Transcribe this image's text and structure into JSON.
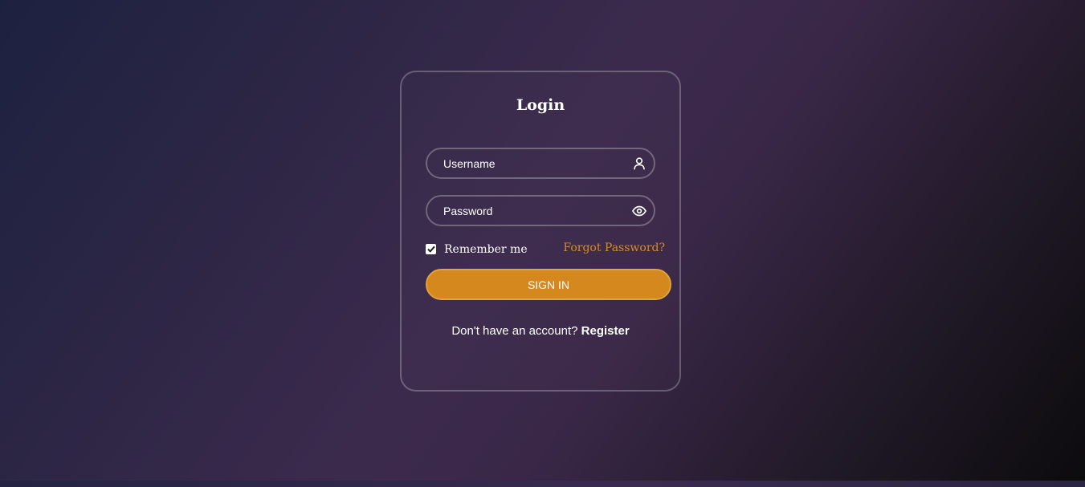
{
  "login": {
    "title": "Login",
    "username": {
      "placeholder": "Username",
      "value": "",
      "icon": "user-icon"
    },
    "password": {
      "placeholder": "Password",
      "value": "",
      "icon": "eye-icon"
    },
    "remember": {
      "label": "Remember me",
      "checked": true
    },
    "forgot_label": "Forgot Password?",
    "signin_label": "SIGN IN",
    "register_prompt": "Don't have an account?",
    "register_label": "Register"
  },
  "colors": {
    "accent": "#d4881e",
    "accent_text": "#d98a22",
    "text": "#ffffff"
  }
}
